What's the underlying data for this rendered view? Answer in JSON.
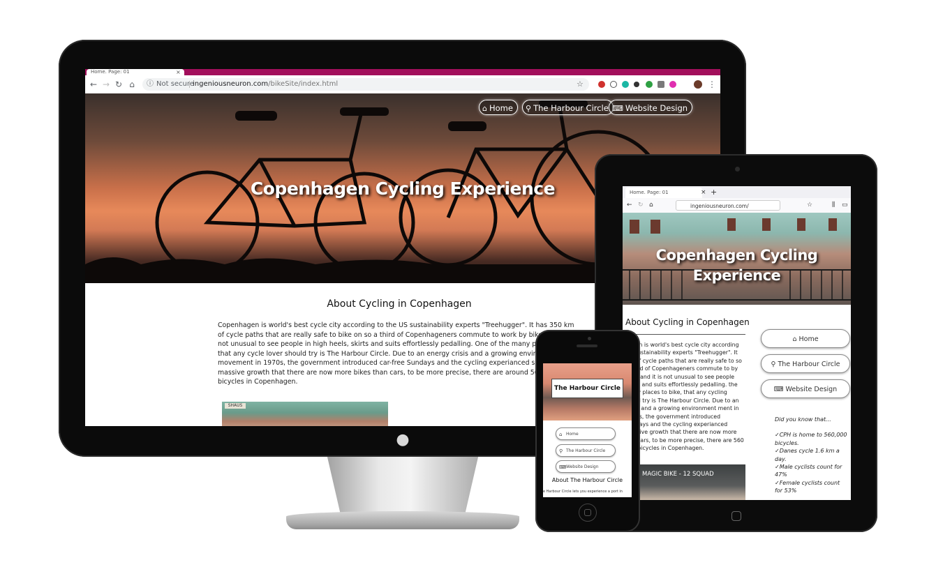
{
  "desktop": {
    "tab_title": "Home. Page: 01",
    "tab_close": "×",
    "not_secure": "Not secure",
    "url_host": "ingeniousneuron.com",
    "url_path": "/bikeSite/index.html",
    "nav": {
      "back": "←",
      "forward": "→",
      "reload": "↻",
      "home": "⌂",
      "info": "ⓘ",
      "star": "☆",
      "menu": "⋮"
    },
    "hero_title": "Copenhagen Cycling Experience",
    "menu": [
      {
        "label": "Home",
        "icon": "home-icon",
        "glyph": "⌂"
      },
      {
        "label": "The Harbour Circle",
        "icon": "bike-icon",
        "glyph": "⚲"
      },
      {
        "label": "Website Design",
        "icon": "code-icon",
        "glyph": "⌨"
      }
    ],
    "heading": "About Cycling in Copenhagen",
    "paragraph": "Copenhagen is world's best cycle city according to the US sustainability experts \"Treehugger\". It has 350 km of cycle paths that are really safe to bike on so a third of Copenhageners commute to work by bike, and it is not unusual to see people in high heels, skirts and suits effortlessly pedalling. One of the many places to bike, that any cycle lover should try is The Harbour Circle. Due to an energy crisis and a growing environment movement in 1970s, the government introduced car-free Sundays and the cycling experianced such a massive growth that there are now more bikes than cars, to be more precise, there are around 560 000 bicycles in Copenhagen.",
    "thumb_sign": "SHAUS"
  },
  "tablet": {
    "tab_title": "Home. Page: 01",
    "tab_close": "×",
    "tab_new": "+",
    "url": "ingeniousneuron.com/",
    "hero_title": "Copenhagen Cycling Experience",
    "heading": "About Cycling in Copenhagen",
    "paragraph": "hagen is world's best cycle city according US sustainability experts \"Treehugger\". It km of cycle paths that are really safe to so a third of Copenhageners commute to by bike, and it is not unusual to see people skirts and suits effortlessly pedalling. the many places to bike, that any cycling hould try is The Harbour Circle. Due to an crisis and a growing environment ment in 1970s, the government introduced Sundays and the cycling experianced massive growth that there are now more han cars, to be more precise, there are 560 000 bicycles in Copenhagen.",
    "menu": [
      {
        "label": "Home",
        "glyph": "⌂"
      },
      {
        "label": "The Harbour Circle",
        "glyph": "⚲"
      },
      {
        "label": "Website Design",
        "glyph": "⌨"
      }
    ],
    "did_you_know": "Did you know that...",
    "facts": [
      "✓CPH is home to 560,000 bicycles.",
      "✓Danes cycle 1.6 km a day.",
      "✓Male cyclists count for 47%",
      "✓Female cyclists count for 53%"
    ],
    "video_title": "MAGIC BIKE - 12 SQUAD"
  },
  "phone": {
    "title": "The Harbour Circle",
    "menu": [
      {
        "label": "Home",
        "glyph": "⌂"
      },
      {
        "label": "The Harbour Circle",
        "glyph": "⚲"
      },
      {
        "label": "Website Design",
        "glyph": "⌨"
      }
    ],
    "heading": "About The Harbour Circle",
    "paragraph": "e Harbour Circle lets you experience a port in"
  },
  "colors": {
    "desktop_tab_bar": "#a20f5b",
    "bezel": "#0b0b0b",
    "sunset": "#e7895a"
  }
}
